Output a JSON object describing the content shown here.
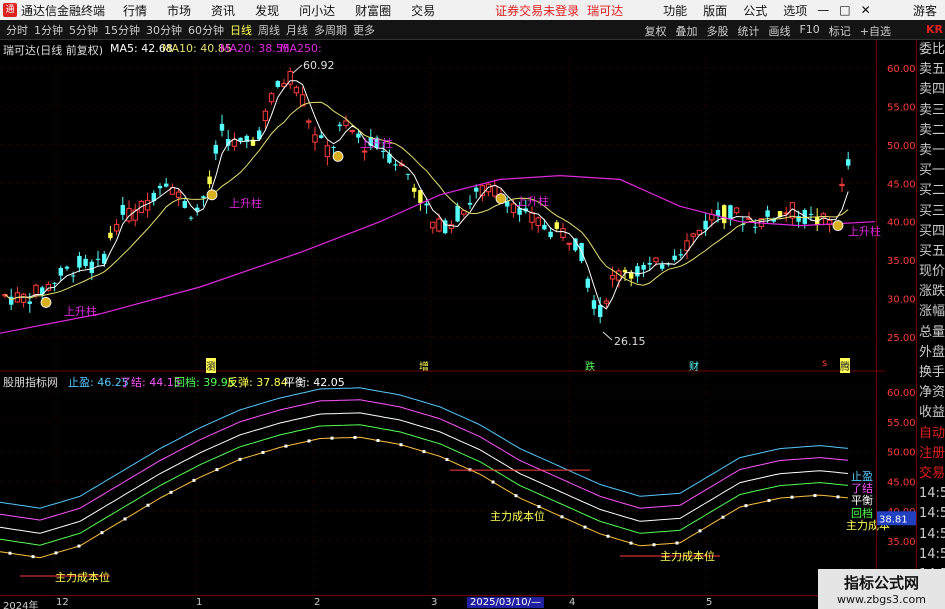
{
  "titlebar": {
    "app_name": "通达信金融终端",
    "menus": [
      "行情",
      "市场",
      "资讯",
      "发现",
      "问小达",
      "财富圈",
      "交易"
    ],
    "alert": "证券交易未登录",
    "stock_name": "瑞可达",
    "right_menus": [
      "功能",
      "版面",
      "公式",
      "选项"
    ],
    "guest": "游客"
  },
  "periodbar": {
    "periods": [
      "分时",
      "1分钟",
      "5分钟",
      "15分钟",
      "30分钟",
      "60分钟",
      "日线",
      "周线",
      "月线",
      "多周期",
      "更多"
    ],
    "active": "日线",
    "right_tools": [
      "复权",
      "叠加",
      "多股",
      "统计",
      "画线",
      "F10",
      "标记",
      "+自选"
    ],
    "brand": "KR"
  },
  "main_panel": {
    "title": "瑞可达(日线 前复权)",
    "ma5": "MA5: 42.68",
    "ma10": "MA10: 40.85",
    "ma20": "MA20: 38.55",
    "ma250": "MA250:",
    "high_label": "60.92",
    "low_label": "26.15",
    "signal_label": "上升柱",
    "markers": [
      "瀏",
      "增",
      "跌",
      "财",
      "s",
      "腾"
    ]
  },
  "indicator_panel": {
    "title": "股朋指标网",
    "stop_profit": "止盈: 46.25",
    "settle": "了结: 44.15",
    "pullback": "回档: 39.95",
    "rebound": "反弹: 37.84",
    "balance": "平衡: 42.05",
    "cost_label": "主力成本位",
    "right_labels": [
      "止盈",
      "了结",
      "平衡",
      "回档",
      "主力成本"
    ],
    "current_value": "38.81"
  },
  "price_axis": [
    "60.00",
    "55.00",
    "50.00",
    "45.00",
    "40.00",
    "35.00",
    "30.00",
    "25.00"
  ],
  "indicator_axis": [
    "60.00",
    "55.00",
    "50.00",
    "45.00",
    "40.00",
    "35.00"
  ],
  "sidepanel": [
    "委比",
    "卖五",
    "卖四",
    "卖三",
    "卖二",
    "卖一",
    "买一",
    "买二",
    "买三",
    "买四",
    "买五",
    "现价",
    "涨跌",
    "涨幅",
    "总量",
    "外盘",
    "换手",
    "净资",
    "收益",
    "自动",
    "注册",
    "交易",
    "14:5",
    "14:5",
    "14:5",
    "14:5",
    "14:5",
    "14:5",
    "14:5"
  ],
  "timeline": {
    "year": "2024年",
    "labels": [
      "12",
      "1",
      "2",
      "3",
      "4",
      "5"
    ],
    "cursor_date": "2025/03/10/—"
  },
  "watermark": {
    "title": "指标公式网",
    "url": "www.zbgs3.com"
  },
  "colors": {
    "up": "#ff3c3c",
    "down": "#54ffff",
    "yellow": "#ffff54",
    "ma5": "#ffffff",
    "ma10": "#e8e070",
    "ma250": "#e028e0",
    "grid_red": "#700000"
  }
}
